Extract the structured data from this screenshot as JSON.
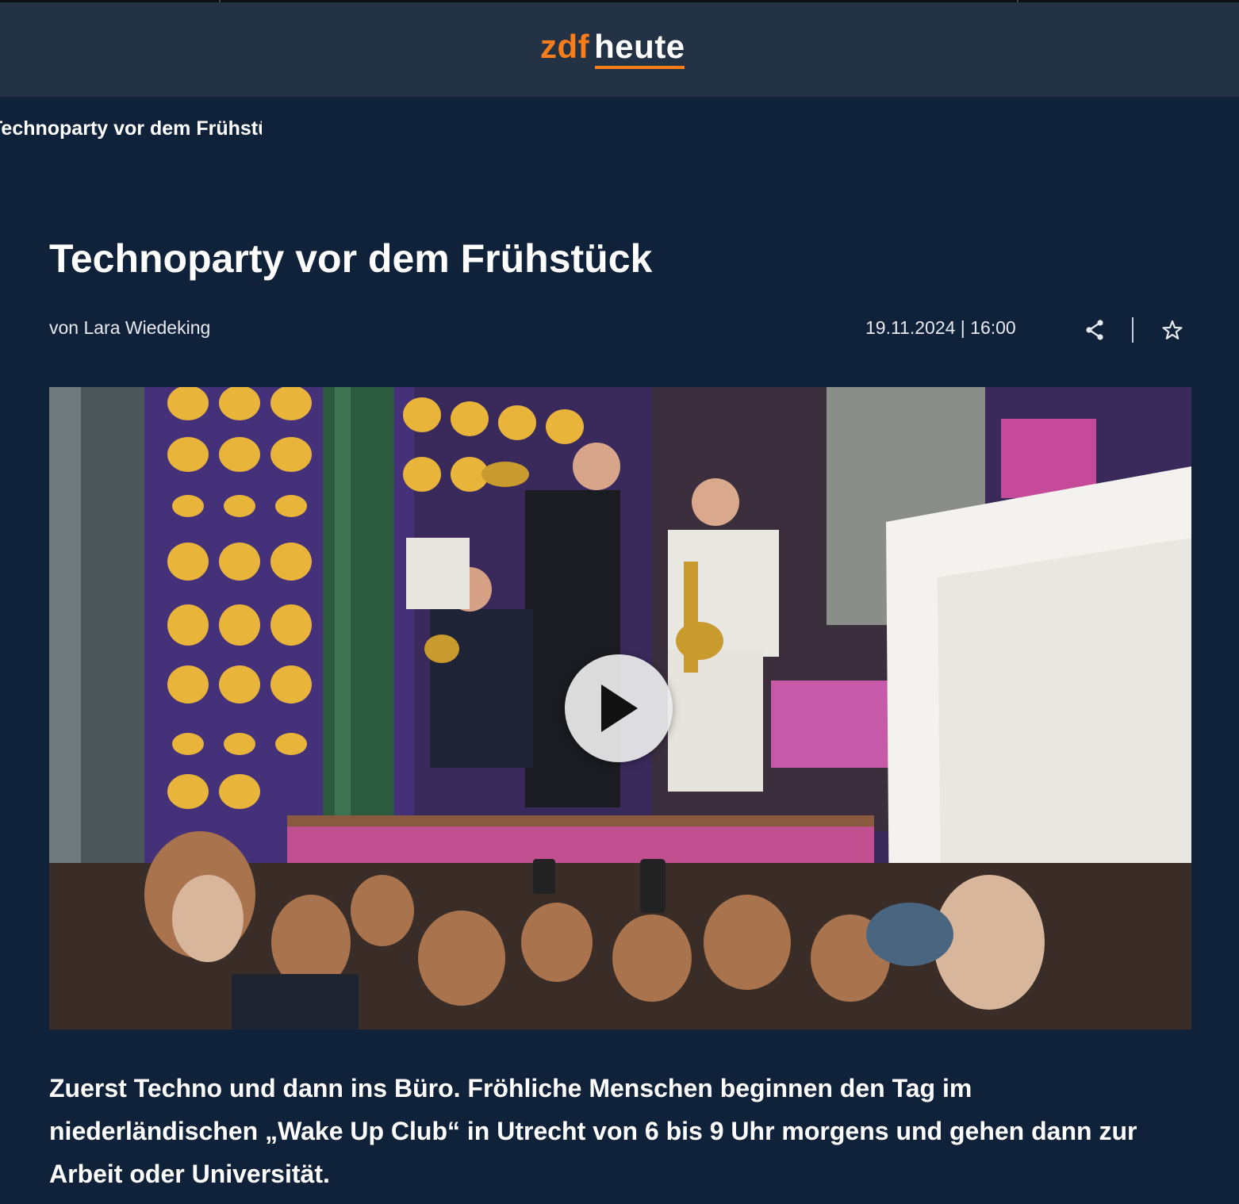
{
  "header": {
    "logo_zdf": "zdf",
    "logo_heute": "heute"
  },
  "breadcrumb": {
    "current": "Technoparty vor dem Frühstück"
  },
  "article": {
    "title": "Technoparty vor dem Frühstück",
    "byline": "von Lara Wiedeking",
    "date": "19.11.2024",
    "separator": "|",
    "time": "16:00",
    "lead": "Zuerst Techno und dann ins Büro. Fröhliche Menschen beginnen den Tag im niederländischen „Wake Up Club“ in Utrecht von 6 bis 9 Uhr morgens und gehen dann zur Arbeit oder Universität."
  },
  "icons": {
    "share": "share-icon",
    "bookmark": "star-icon",
    "play": "play-icon"
  },
  "colors": {
    "page_background": "#10223a",
    "header_background": "#233244",
    "brand_orange": "#fa7d19",
    "text": "#ffffff"
  }
}
